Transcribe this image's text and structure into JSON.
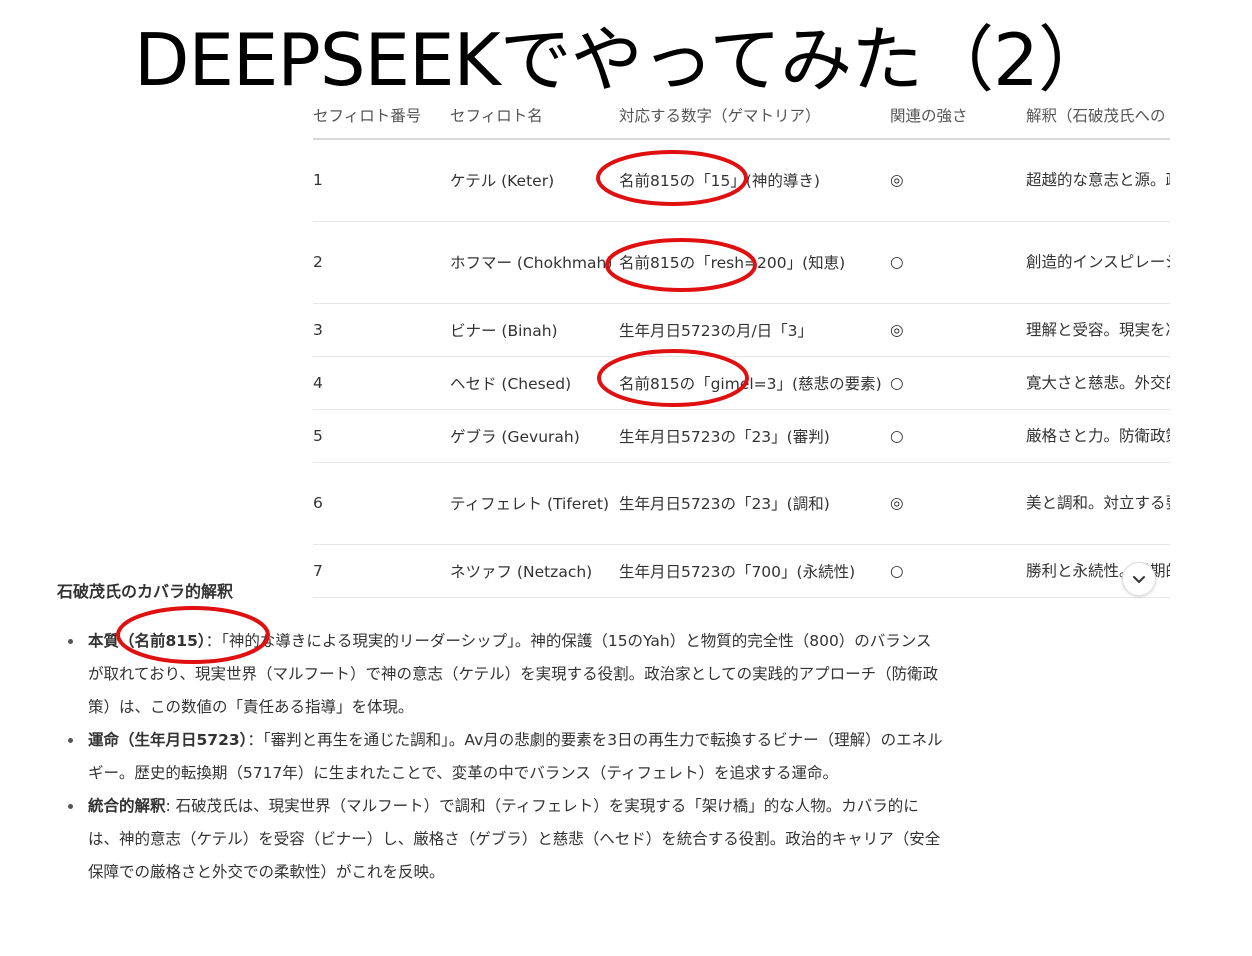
{
  "slide": {
    "title": "DEEPSEEKでやってみた（2）"
  },
  "table": {
    "headers": [
      "セフィロト番号",
      "セフィロト名",
      "対応する数字（ゲマトリア）",
      "関連の強さ",
      "解釈（石破茂氏への"
    ],
    "rows": [
      {
        "num": "1",
        "name": "ケテル (Keter)",
        "number": "名前815の「15」(神的導き)",
        "strength": "◎",
        "interp": "超越的な意志と源。政治における使命感（政治の神聖化）がある。"
      },
      {
        "num": "2",
        "name": "ホフマー (Chokhmah)",
        "number": "名前815の「resh=200」(知恵)",
        "strength": "○",
        "interp": "創造的インスピレーション（政策による改革）。"
      },
      {
        "num": "3",
        "name": "ビナー (Binah)",
        "number": "生年月日5723の月/日「3」",
        "strength": "◎",
        "interp": "理解と受容。現実を冷静に分析する。"
      },
      {
        "num": "4",
        "name": "ヘセド (Chesed)",
        "number": "名前815の「gimel=3」(慈悲の要素)",
        "strength": "○",
        "interp": "寛大さと慈悲。外交的な柔軟さ。"
      },
      {
        "num": "5",
        "name": "ゲブラ (Gevurah)",
        "number": "生年月日5723の「23」(審判)",
        "strength": "○",
        "interp": "厳格さと力。防衛政策に表れる。"
      },
      {
        "num": "6",
        "name": "ティフェレト (Tiferet)",
        "number": "生年月日5723の「23」(調和)",
        "strength": "◎",
        "interp": "美と調和。対立する要素を統合する中心的なエネルギー。"
      },
      {
        "num": "7",
        "name": "ネツァフ (Netzach)",
        "number": "生年月日5723の「700」(永続性)",
        "strength": "○",
        "interp": "勝利と永続性。長期的な視野。"
      }
    ]
  },
  "analysis": {
    "heading": "石破茂氏のカバラ的解釈",
    "items": [
      {
        "label": "本質（名前815）",
        "text": "：「神的な導きによる現実的リーダーシップ」。神的保護（15のYah）と物質的完全性（800）のバランスが取れており、現実世界（マルフート）で神の意志（ケテル）を実現する役割。政治家としての実践的アプローチ（防衛政策）は、この数値の「責任ある指導」を体現。"
      },
      {
        "label": "運命（生年月日5723）",
        "text": "：「審判と再生を通じた調和」。Av月の悲劇的要素を3日の再生力で転換するビナー（理解）のエネルギー。歴史的転換期（5717年）に生まれたことで、変革の中でバランス（ティフェレト）を追求する運命。"
      },
      {
        "label": "統合的解釈",
        "text": ": 石破茂氏は、現実世界（マルフート）で調和（ティフェレト）を実現する「架け橋」的な人物。カバラ的には、神的意志（ケテル）を受容（ビナー）し、厳格さ（ゲブラ）と慈悲（ヘセド）を統合する役割。政治的キャリア（安全保障での厳格さと外交での柔軟性）がこれを反映。"
      }
    ]
  },
  "icons": {
    "scroll": "chevron-down-icon"
  },
  "colors": {
    "annotation": "#e01010",
    "text": "#333333"
  }
}
